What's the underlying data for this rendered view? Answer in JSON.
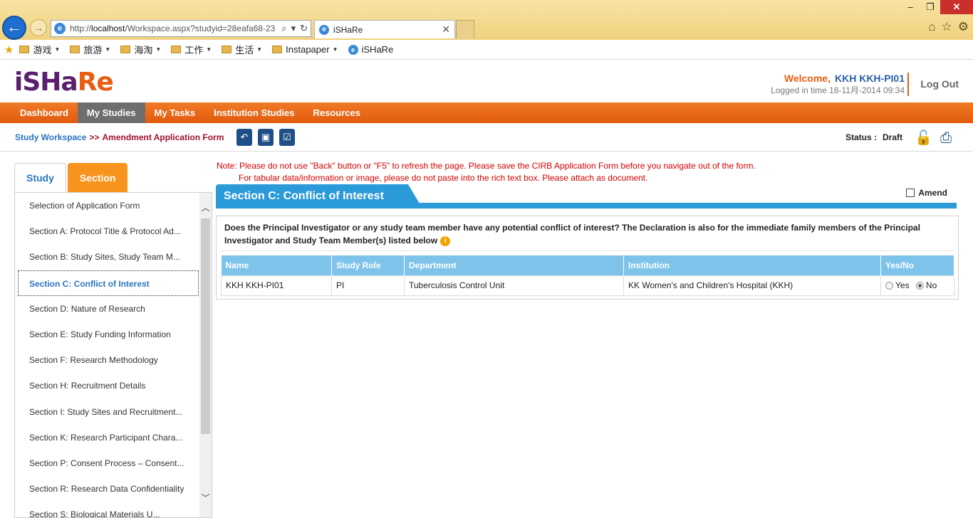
{
  "browser": {
    "url_prefix": "http://",
    "url_host": "localhost",
    "url_rest": "/Workspace.aspx?studyid=28eafa68-23",
    "tab_title": "iSHaRe",
    "favorites": [
      "游戏",
      "旅游",
      "海淘",
      "工作",
      "生活",
      "Instapaper",
      "iSHaRe"
    ]
  },
  "header": {
    "logo_main": "iSHa",
    "logo_accent": "Re",
    "welcome_label": "Welcome,",
    "user_name": "KKH KKH-PI01",
    "logged_in": "Logged in time 18-11月-2014 09:34",
    "logout": "Log Out"
  },
  "nav": {
    "items": [
      "Dashboard",
      "My Studies",
      "My Tasks",
      "Institution Studies",
      "Resources"
    ],
    "active": "My Studies"
  },
  "breadcrumb": {
    "workspace": "Study Workspace",
    "separator": ">>",
    "current": "Amendment Application Form"
  },
  "status": {
    "label": "Status :",
    "value": "Draft"
  },
  "side": {
    "tabs": [
      "Study",
      "Section"
    ],
    "items": [
      "Selection of Application Form",
      "Section A: Protocol Title & Protocol Ad...",
      "Section B: Study Sites, Study Team M...",
      "Section C: Conflict of Interest",
      "Section D: Nature of Research",
      "Section E: Study Funding Information",
      "Section F: Research Methodology",
      "Section H: Recruitment Details",
      "Section I: Study Sites and Recruitment...",
      "Section K: Research Participant Chara...",
      "Section P: Consent Process – Consent...",
      "Section R: Research Data Confidentiality",
      "Section S: Biological Materials U..."
    ]
  },
  "note": {
    "line1": "Note: Please do not use \"Back\" button or \"F5\" to refresh the page. Please save the CIRB Application Form before you navigate out of the form.",
    "line2": "For tabular data/information or image, please do not paste into the rich text box. Please attach as document."
  },
  "section": {
    "title": "Section C: Conflict of Interest",
    "amend_label": "Amend",
    "question": "Does the Principal Investigator or any study team member have any potential conflict of interest? The Declaration is also for the immediate family members of the Principal Investigator and  Study Team Member(s) listed below",
    "table": {
      "headers": [
        "Name",
        "Study Role",
        "Department",
        "Institution",
        "Yes/No"
      ],
      "rows": [
        {
          "name": "KKH KKH-PI01",
          "role": "PI",
          "department": "Tuberculosis Control Unit",
          "institution": "KK Women's and Children's Hospital (KKH)",
          "yes": "Yes",
          "no": "No",
          "selected": "No"
        }
      ]
    }
  }
}
